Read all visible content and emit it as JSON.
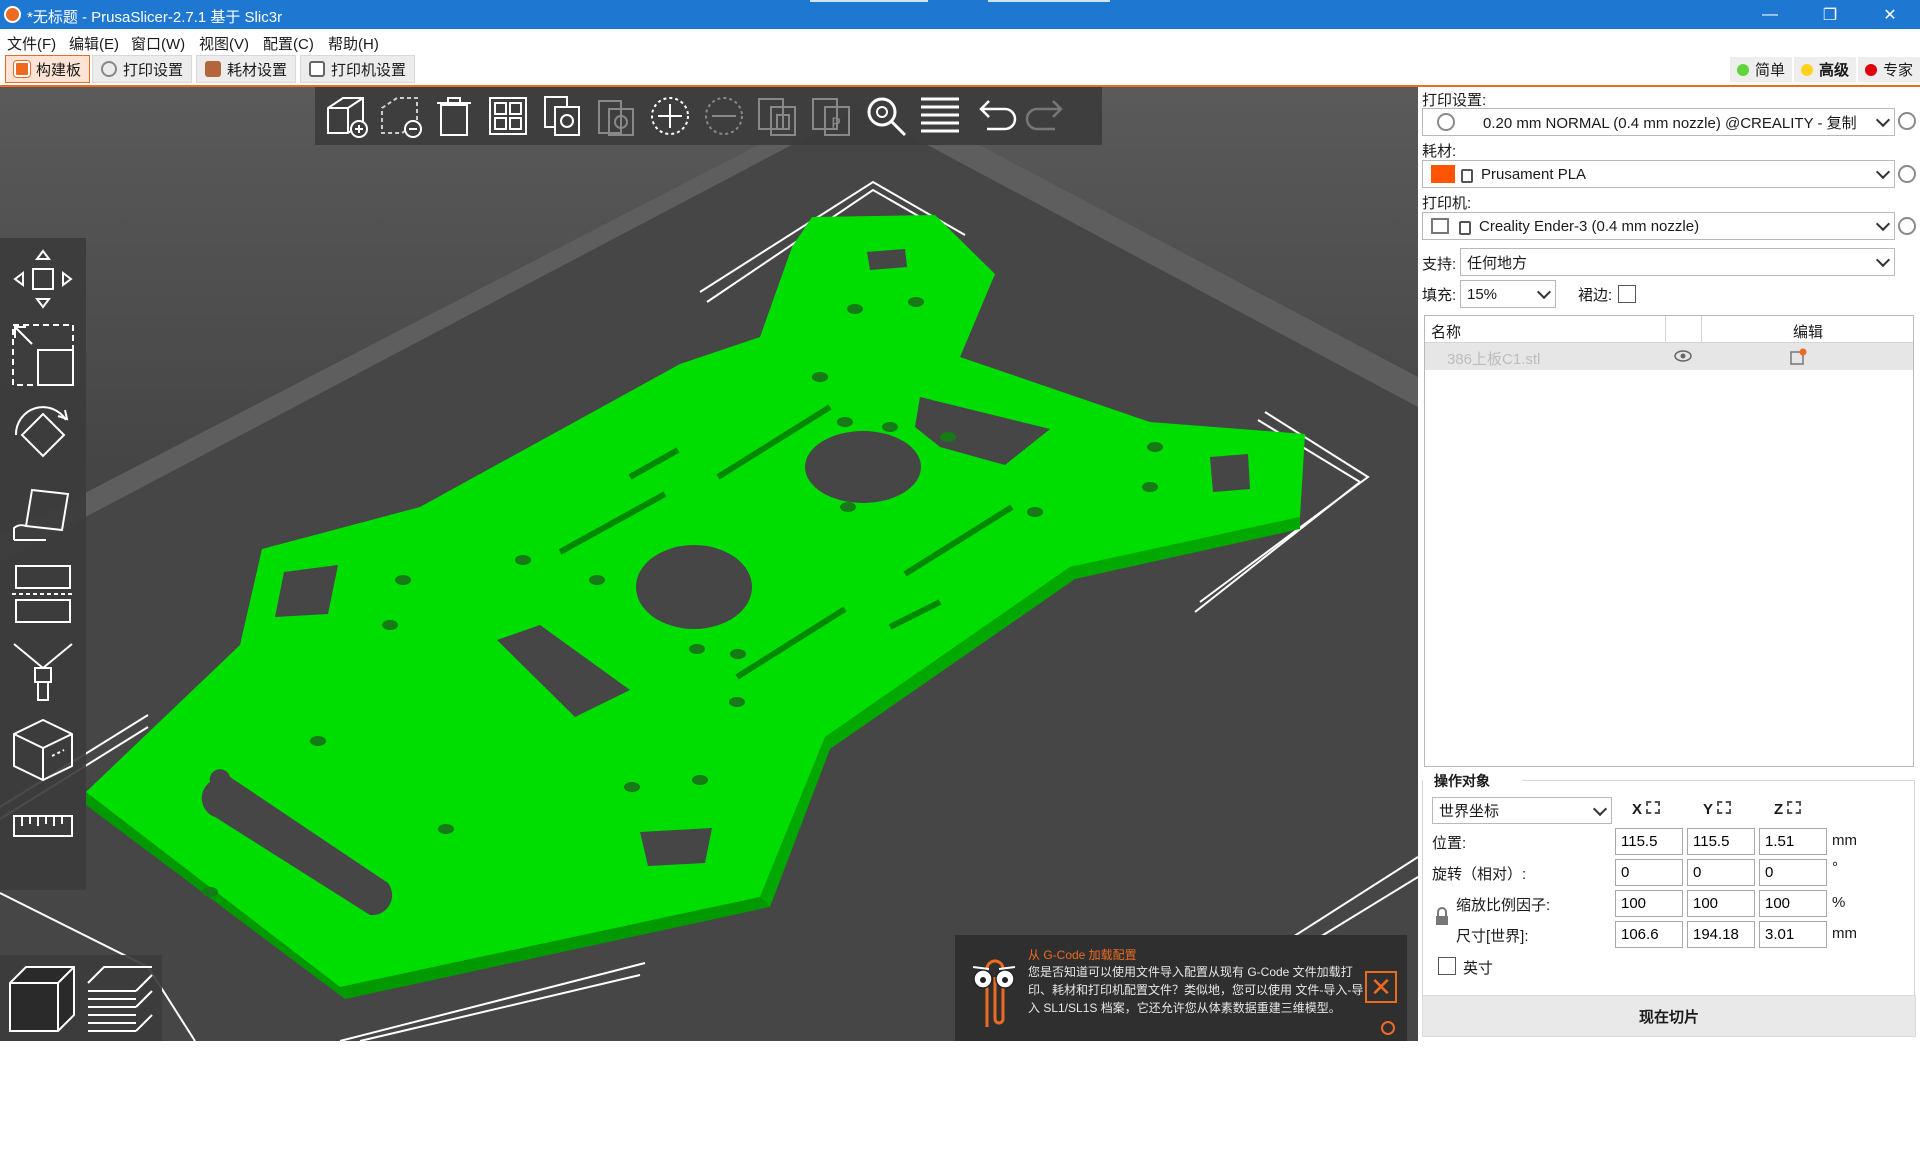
{
  "window": {
    "title": "*无标题 - PrusaSlicer-2.7.1 基于 Slic3r",
    "minimize": "—",
    "maximize": "❐",
    "close": "✕"
  },
  "menu": [
    "文件(F)",
    "编辑(E)",
    "窗口(W)",
    "视图(V)",
    "配置(C)",
    "帮助(H)"
  ],
  "tabs": [
    {
      "label": "构建板",
      "active": true
    },
    {
      "label": "打印设置",
      "active": false
    },
    {
      "label": "耗材设置",
      "active": false
    },
    {
      "label": "打印机设置",
      "active": false
    }
  ],
  "modes": [
    {
      "label": "简单",
      "color": "#5fd43b"
    },
    {
      "label": "高级",
      "color": "#ffd21e"
    },
    {
      "label": "专家",
      "color": "#e0000a"
    }
  ],
  "colors": {
    "accent": "#ed6b21",
    "model": "#00dd00",
    "filament": "#ff5500"
  },
  "sidebar": {
    "print_label": "打印设置:",
    "print_value": "0.20 mm NORMAL (0.4 mm nozzle) @CREALITY - 复制",
    "filament_label": "耗材:",
    "filament_value": "Prusament PLA",
    "printer_label": "打印机:",
    "printer_value": "Creality Ender-3 (0.4 mm nozzle)",
    "support_label": "支持:",
    "support_value": "任何地方",
    "infill_label": "填充:",
    "infill_value": "15%",
    "brim_label": "裙边:",
    "objects": {
      "col_name": "名称",
      "col_edit": "编辑",
      "rows": [
        {
          "name": "386上板C1.stl"
        }
      ]
    },
    "manip": {
      "title": "操作对象",
      "coord_system": "世界坐标",
      "axes": [
        "X",
        "Y",
        "Z"
      ],
      "position_label": "位置:",
      "position": [
        "115.5",
        "115.5",
        "1.51"
      ],
      "position_unit": "mm",
      "rotation_label": "旋转（相对）:",
      "rotation": [
        "0",
        "0",
        "0"
      ],
      "rotation_unit": "°",
      "scale_label": "缩放比例因子:",
      "scale": [
        "100",
        "100",
        "100"
      ],
      "scale_unit": "%",
      "size_label": "尺寸[世界]:",
      "size": [
        "106.6",
        "194.18",
        "3.01"
      ],
      "size_unit": "mm",
      "inches_label": "英寸"
    },
    "slice_button": "现在切片"
  },
  "notification": {
    "title": "从 G-Code 加载配置",
    "body": "您是否知道可以使用文件导入配置从现有 G-Code 文件加载打印、耗材和打印机配置文件？类似地，您可以使用 文件-导入-导入 SL1/SL1S 档案，它还允许您从体素数据重建三维模型。"
  }
}
